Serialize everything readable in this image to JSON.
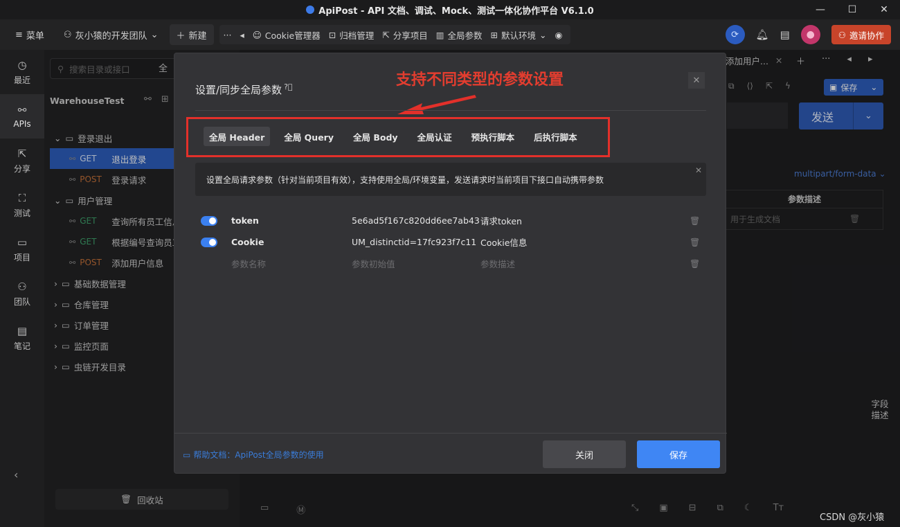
{
  "window": {
    "title": "ApiPost - API 文档、调试、Mock、测试一体化协作平台 V6.1.0"
  },
  "toolbar": {
    "menu_label": "菜单",
    "team_label": "灰小猿的开发团队",
    "new_label": "新建",
    "more_label": "···",
    "cookie_label": "Cookie管理器",
    "archive_label": "归档管理",
    "share_label": "分享项目",
    "global_params_label": "全局参数",
    "env_label": "默认环境",
    "invite_label": "邀请协作"
  },
  "leftnav": [
    {
      "label": "最近",
      "icon": "history-icon"
    },
    {
      "label": "APIs",
      "icon": "api-icon"
    },
    {
      "label": "分享",
      "icon": "share-icon"
    },
    {
      "label": "测试",
      "icon": "test-icon"
    },
    {
      "label": "项目",
      "icon": "project-icon"
    },
    {
      "label": "团队",
      "icon": "team-icon"
    },
    {
      "label": "笔记",
      "icon": "note-icon"
    }
  ],
  "tree": {
    "search_placeholder": "搜索目录或接口",
    "search_all": "全",
    "project_name": "WarehouseTest",
    "items": [
      {
        "type": "folder",
        "label": "登录退出"
      },
      {
        "type": "req",
        "method": "GET",
        "label": "退出登录",
        "selected": true
      },
      {
        "type": "req",
        "method": "POST",
        "label": "登录请求"
      },
      {
        "type": "folder",
        "label": "用户管理"
      },
      {
        "type": "req",
        "method": "GET",
        "label": "查询所有员工信息"
      },
      {
        "type": "req",
        "method": "GET",
        "label": "根据编号查询员工"
      },
      {
        "type": "req",
        "method": "POST",
        "label": "添加用户信息"
      },
      {
        "type": "folder",
        "label": "基础数据管理"
      },
      {
        "type": "folder",
        "label": "仓库管理"
      },
      {
        "type": "folder",
        "label": "订单管理"
      },
      {
        "type": "folder",
        "label": "监控页面"
      },
      {
        "type": "folder",
        "label": "虫链开发目录"
      }
    ],
    "recycle_label": "回收站"
  },
  "main": {
    "tab_label": "添加用户...",
    "save_label": "保存",
    "send_label": "发送",
    "content_type": "multipart/form-data",
    "param_desc_header": "参数描述",
    "param_desc_placeholder": "用于生成文档",
    "field_desc": "字段描述",
    "watermark": "CSDN @灰小猿"
  },
  "modal": {
    "title": "设置/同步全局参数",
    "annotation": "支持不同类型的参数设置",
    "tabs": [
      "全局 Header",
      "全局 Query",
      "全局 Body",
      "全局认证",
      "预执行脚本",
      "后执行脚本"
    ],
    "notice": "设置全局请求参数（针对当前项目有效），支持使用全局/环境变量，发送请求时当前项目下接口自动携带参数",
    "params": [
      {
        "name": "token",
        "value": "5e6ad5f167c820dd6ee7ab43",
        "desc": "请求token",
        "enabled": true
      },
      {
        "name": "Cookie",
        "value": "UM_distinctid=17fc923f7c11",
        "desc": "Cookie信息",
        "enabled": true
      }
    ],
    "placeholders": {
      "name": "参数名称",
      "value": "参数初始值",
      "desc": "参数描述"
    },
    "help_link": "帮助文档：ApiPost全局参数的使用",
    "close_label": "关闭",
    "save_label": "保存"
  }
}
